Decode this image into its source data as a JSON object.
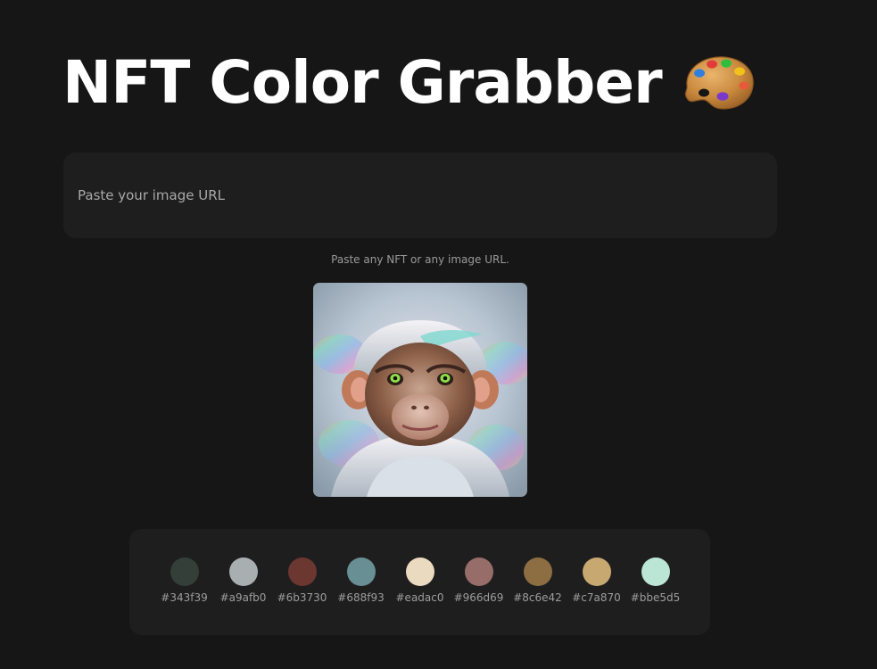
{
  "header": {
    "title": "NFT Color Grabber"
  },
  "search": {
    "placeholder": "Paste your image URL",
    "value": "",
    "hint": "Paste any NFT or any image URL."
  },
  "preview": {
    "alt": "NFT monkey artwork"
  },
  "swatches": [
    {
      "color": "#343f39",
      "label": "#343f39"
    },
    {
      "color": "#a9afb0",
      "label": "#a9afb0"
    },
    {
      "color": "#6b3730",
      "label": "#6b3730"
    },
    {
      "color": "#688f93",
      "label": "#688f93"
    },
    {
      "color": "#eadac0",
      "label": "#eadac0"
    },
    {
      "color": "#966d69",
      "label": "#966d69"
    },
    {
      "color": "#8c6e42",
      "label": "#8c6e42"
    },
    {
      "color": "#c7a870",
      "label": "#c7a870"
    },
    {
      "color": "#bbe5d5",
      "label": "#bbe5d5"
    }
  ],
  "colors": {
    "background": "#161616",
    "panel": "#1f1e1f",
    "title": "#ffffff",
    "muted_text": "#9a9a9a"
  }
}
